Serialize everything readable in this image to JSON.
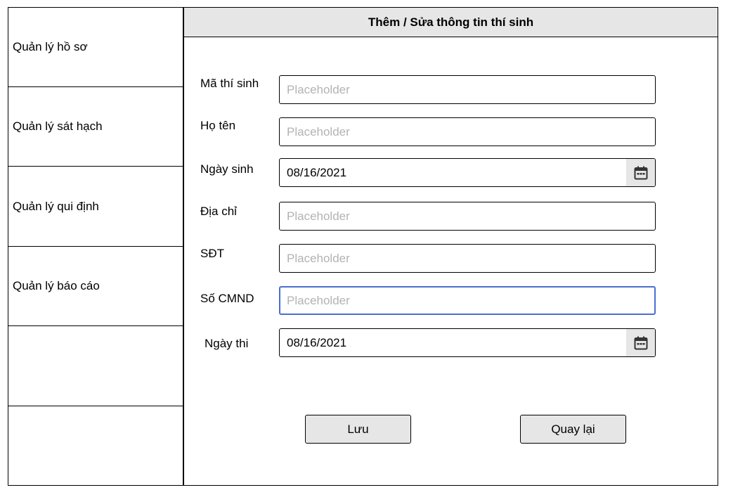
{
  "sidebar": {
    "items": [
      {
        "label": "Quản lý hồ sơ"
      },
      {
        "label": "Quản lý sát hạch"
      },
      {
        "label": "Quản lý qui định"
      },
      {
        "label": "Quản lý báo cáo"
      },
      {
        "label": ""
      },
      {
        "label": ""
      }
    ]
  },
  "form": {
    "title": "Thêm / Sửa thông tin thí sinh",
    "fields": {
      "ma_thi_sinh": {
        "label": "Mã thí sinh",
        "placeholder": "Placeholder",
        "value": ""
      },
      "ho_ten": {
        "label": "Họ tên",
        "placeholder": "Placeholder",
        "value": ""
      },
      "ngay_sinh": {
        "label": "Ngày sinh",
        "value": "08/16/2021"
      },
      "dia_chi": {
        "label": "Địa chỉ",
        "placeholder": "Placeholder",
        "value": ""
      },
      "sdt": {
        "label": "SĐT",
        "placeholder": "Placeholder",
        "value": ""
      },
      "so_cmnd": {
        "label": "Số CMND",
        "placeholder": "Placeholder",
        "value": ""
      },
      "ngay_thi": {
        "label": "Ngày thi",
        "value": "08/16/2021"
      }
    },
    "buttons": {
      "save_label": "Lưu",
      "back_label": "Quay lại"
    }
  },
  "icons": {
    "date_picker": "calendar-icon"
  },
  "colors": {
    "focus_border": "#4a6fd1",
    "header_bg": "#e6e6e6",
    "button_bg": "#e6e6e6",
    "placeholder_text": "#b3b3b3"
  }
}
